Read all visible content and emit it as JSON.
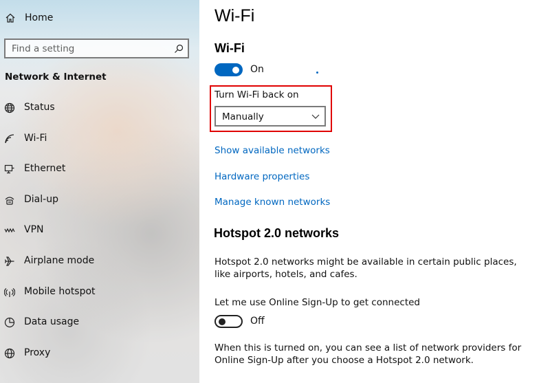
{
  "sidebar": {
    "home_label": "Home",
    "search_placeholder": "Find a setting",
    "section_title": "Network & Internet",
    "items": [
      {
        "label": "Status",
        "icon": "globe-icon"
      },
      {
        "label": "Wi-Fi",
        "icon": "wifi-icon"
      },
      {
        "label": "Ethernet",
        "icon": "ethernet-icon"
      },
      {
        "label": "Dial-up",
        "icon": "dial-up-icon"
      },
      {
        "label": "VPN",
        "icon": "vpn-icon"
      },
      {
        "label": "Airplane mode",
        "icon": "airplane-icon"
      },
      {
        "label": "Mobile hotspot",
        "icon": "hotspot-icon"
      },
      {
        "label": "Data usage",
        "icon": "data-usage-icon"
      },
      {
        "label": "Proxy",
        "icon": "globe-icon"
      }
    ]
  },
  "main": {
    "page_title": "Wi-Fi",
    "wifi_heading": "Wi-Fi",
    "wifi_toggle": {
      "state": "On",
      "on": true
    },
    "turn_back_on": {
      "label": "Turn Wi-Fi back on",
      "value": "Manually"
    },
    "links": [
      "Show available networks",
      "Hardware properties",
      "Manage known networks"
    ],
    "hotspot": {
      "heading": "Hotspot 2.0 networks",
      "description_line1": "Hotspot 2.0 networks might be available in certain public places,",
      "description_line2": "like airports, hotels, and cafes.",
      "signup_label": "Let me use Online Sign-Up to get connected",
      "signup_toggle": {
        "state": "Off",
        "on": false
      },
      "footer_line1": "When this is turned on, you can see a list of network providers for",
      "footer_line2": "Online Sign-Up after you choose a Hotspot 2.0 network."
    }
  },
  "colors": {
    "accent": "#0067c0",
    "highlight": "#e00000"
  }
}
